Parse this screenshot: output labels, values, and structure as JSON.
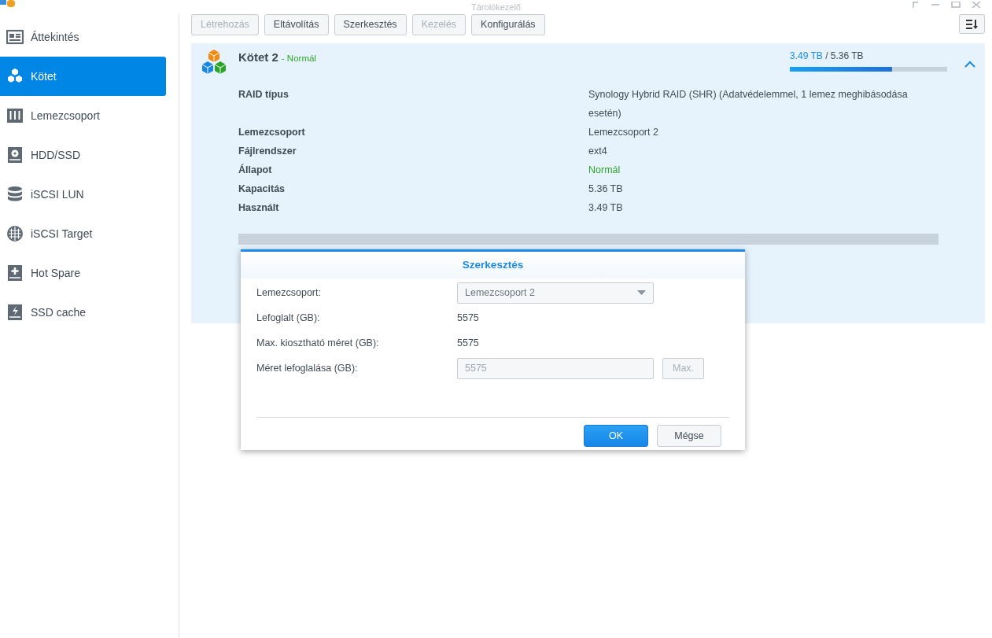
{
  "window": {
    "title": "Tárolókezelő"
  },
  "sidebar": {
    "items": [
      {
        "label": "Áttekintés",
        "selected": false
      },
      {
        "label": "Kötet",
        "selected": true
      },
      {
        "label": "Lemezcsoport",
        "selected": false
      },
      {
        "label": "HDD/SSD",
        "selected": false
      },
      {
        "label": "iSCSI LUN",
        "selected": false
      },
      {
        "label": "iSCSI Target",
        "selected": false
      },
      {
        "label": "Hot Spare",
        "selected": false
      },
      {
        "label": "SSD cache",
        "selected": false
      }
    ]
  },
  "toolbar": {
    "buttons": [
      {
        "label": "Létrehozás",
        "disabled": true
      },
      {
        "label": "Eltávolítás",
        "disabled": false
      },
      {
        "label": "Szerkesztés",
        "disabled": false
      },
      {
        "label": "Kezelés",
        "disabled": true
      },
      {
        "label": "Konfigurálás",
        "disabled": false
      }
    ]
  },
  "volume": {
    "name": "Kötet 2",
    "status": "- Normál",
    "used": "3.49 TB",
    "total": "/ 5.36 TB",
    "level": 0.65,
    "expanded": true,
    "details": [
      {
        "label": "RAID típus",
        "value": "Synology Hybrid RAID (SHR) (Adatvédelemmel, 1 lemez meghibásodása esetén)",
        "kind": "text"
      },
      {
        "label": "Lemezcsoport",
        "value": "Lemezcsoport 2",
        "kind": "text"
      },
      {
        "label": "Fájlrendszer",
        "value": "ext4",
        "kind": "text"
      },
      {
        "label": "Állapot",
        "value": "Normál",
        "kind": "status"
      },
      {
        "label": "Kapacitás",
        "value": "5.36 TB",
        "kind": "text"
      },
      {
        "label": "Használt",
        "value": "3.49 TB",
        "kind": "text"
      }
    ]
  },
  "dialog": {
    "title": "Szerkesztés",
    "fields": [
      {
        "label": "Lemezcsoport:",
        "kind": "select",
        "value": "Lemezcsoport 2"
      },
      {
        "label": "Lefoglalt (GB):",
        "kind": "text",
        "value": "5575"
      },
      {
        "label": "Max. kiosztható méret (GB):",
        "kind": "text",
        "value": "5575"
      },
      {
        "label": "Méret lefoglalása (GB):",
        "kind": "input",
        "value": "5575",
        "button": {
          "label": "Max.",
          "disabled": true
        }
      }
    ],
    "buttons": [
      {
        "label": "OK",
        "primary": true
      },
      {
        "label": "Mégse",
        "primary": false
      }
    ]
  }
}
